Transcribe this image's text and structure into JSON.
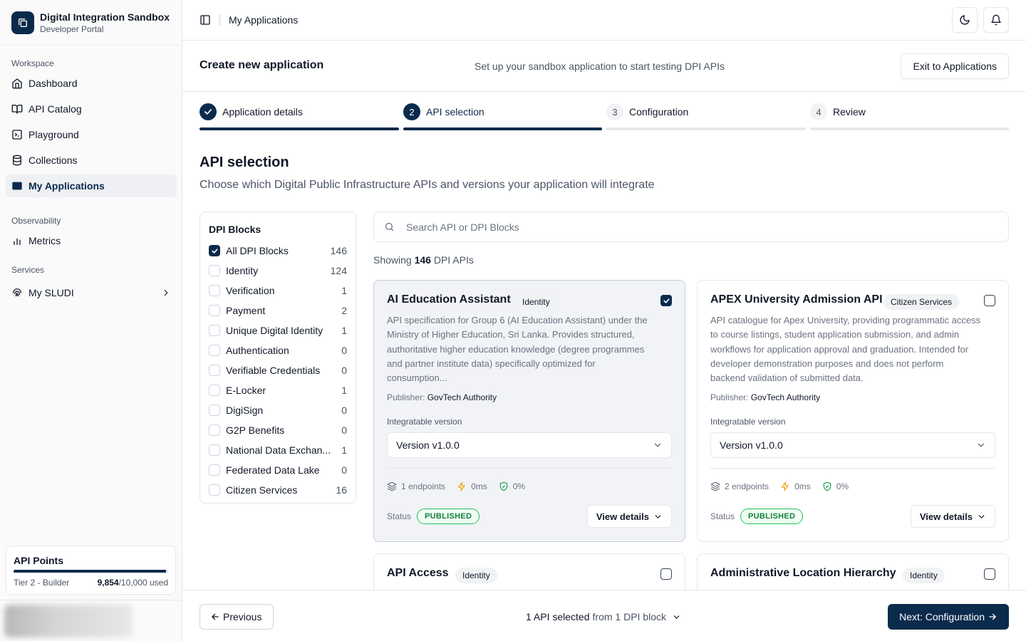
{
  "brand": {
    "title": "Digital Integration Sandbox",
    "subtitle": "Developer Portal"
  },
  "sidebar": {
    "groups": [
      {
        "label": "Workspace",
        "items": [
          {
            "label": "Dashboard",
            "icon": "home-icon"
          },
          {
            "label": "API Catalog",
            "icon": "book-open-icon"
          },
          {
            "label": "Playground",
            "icon": "terminal-icon"
          },
          {
            "label": "Collections",
            "icon": "database-icon"
          },
          {
            "label": "My Applications",
            "icon": "app-window-icon",
            "active": true
          }
        ]
      },
      {
        "label": "Observability",
        "items": [
          {
            "label": "Metrics",
            "icon": "bar-chart-icon"
          }
        ]
      },
      {
        "label": "Services",
        "items": [
          {
            "label": "My SLUDI",
            "icon": "fingerprint-icon"
          }
        ]
      }
    ],
    "points": {
      "title": "API Points",
      "tier": "Tier 2 - Builder",
      "used": "9,854",
      "total": "/10,000 used",
      "fraction": 0.9854
    }
  },
  "header": {
    "breadcrumb": "My Applications"
  },
  "wizard": {
    "title": "Create new application",
    "description": "Set up your sandbox application to start testing DPI APIs",
    "exit_label": "Exit to Applications",
    "steps": [
      {
        "num": "1",
        "label": "Application details",
        "state": "done"
      },
      {
        "num": "2",
        "label": "API selection",
        "state": "current"
      },
      {
        "num": "3",
        "label": "Configuration",
        "state": "pending"
      },
      {
        "num": "4",
        "label": "Review",
        "state": "pending"
      }
    ]
  },
  "section": {
    "title": "API selection",
    "description": "Choose which Digital Public Infrastructure APIs and versions your application will integrate"
  },
  "filters": {
    "title": "DPI Blocks",
    "items": [
      {
        "label": "All DPI Blocks",
        "count": "146",
        "checked": true
      },
      {
        "label": "Identity",
        "count": "124",
        "checked": false
      },
      {
        "label": "Verification",
        "count": "1",
        "checked": false
      },
      {
        "label": "Payment",
        "count": "2",
        "checked": false
      },
      {
        "label": "Unique Digital Identity",
        "count": "1",
        "checked": false
      },
      {
        "label": "Authentication",
        "count": "0",
        "checked": false
      },
      {
        "label": "Verifiable Credentials",
        "count": "0",
        "checked": false
      },
      {
        "label": "E-Locker",
        "count": "1",
        "checked": false
      },
      {
        "label": "DigiSign",
        "count": "0",
        "checked": false
      },
      {
        "label": "G2P Benefits",
        "count": "0",
        "checked": false
      },
      {
        "label": "National Data Exchan...",
        "count": "1",
        "checked": false
      },
      {
        "label": "Federated Data Lake",
        "count": "0",
        "checked": false
      },
      {
        "label": "Citizen Services",
        "count": "16",
        "checked": false
      }
    ]
  },
  "search": {
    "placeholder": "Search API or DPI Blocks"
  },
  "results": {
    "prefix": "Showing",
    "count": "146",
    "suffix": "DPI APIs"
  },
  "cards": [
    {
      "name": "AI Education Assistant",
      "tag": "Identity",
      "selected": true,
      "description": "API specification for Group 6 (AI Education Assistant) under the Ministry of Higher Education, Sri Lanka. Provides structured, authoritative higher education knowledge (degree programmes and partner institute data) specifically optimized for consumption...",
      "publisher_label": "Publisher:",
      "publisher": "GovTech Authority",
      "version_label": "Integratable version",
      "version": "Version v1.0.0",
      "endpoints": "1 endpoints",
      "latency": "0ms",
      "uptime": "0%",
      "status_label": "Status",
      "status": "PUBLISHED",
      "view_label": "View details"
    },
    {
      "name": "APEX University Admission API",
      "tag": "Citizen Services",
      "selected": false,
      "description": "API catalogue for Apex University, providing programmatic access to course listings, student application submission, and admin workflows for application approval and graduation. Intended for developer demonstration purposes and does not perform backend validation of submitted data.",
      "publisher_label": "Publisher:",
      "publisher": "GovTech Authority",
      "version_label": "Integratable version",
      "version": "Version v1.0.0",
      "endpoints": "2 endpoints",
      "latency": "0ms",
      "uptime": "0%",
      "status_label": "Status",
      "status": "PUBLISHED",
      "view_label": "View details"
    },
    {
      "name": "API Access",
      "tag": "Identity",
      "selected": false
    },
    {
      "name": "Administrative Location Hierarchy",
      "tag": "Identity",
      "selected": false
    }
  ],
  "footer": {
    "prev_label": "Previous",
    "selected_text": "1 API selected",
    "from_text": "from 1 DPI block",
    "next_label": "Next: Configuration"
  },
  "colors": {
    "primary": "#0b2b4c",
    "published": "#15803d",
    "bolt": "#f59e0b",
    "shield": "#16a34a"
  }
}
